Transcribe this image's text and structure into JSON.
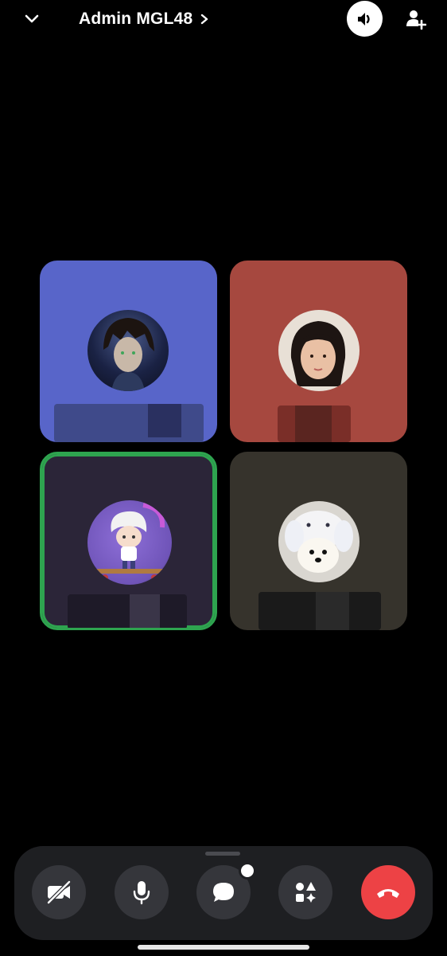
{
  "header": {
    "title": "Admin MGL48",
    "collapse_icon": "chevron-down-icon",
    "detail_icon": "chevron-right-icon",
    "speaker_icon": "speaker-icon",
    "add_user_icon": "add-user-icon"
  },
  "participants": [
    {
      "tile_color": "#5865c9",
      "avatar": "anime-boy-avatar",
      "name_redacted": true,
      "speaking": false
    },
    {
      "tile_color": "#a6483f",
      "avatar": "girl-photo-avatar",
      "name_redacted": true,
      "speaking": false
    },
    {
      "tile_color": "#2b2538",
      "avatar": "chibi-skateboard-avatar",
      "name_redacted": true,
      "speaking": true
    },
    {
      "tile_color": "#36332c",
      "avatar": "dog-costume-avatar",
      "name_redacted": true,
      "speaking": false
    }
  ],
  "call_controls": [
    {
      "icon": "camera-off-icon",
      "action": "toggle-camera"
    },
    {
      "icon": "microphone-icon",
      "action": "toggle-mic"
    },
    {
      "icon": "chat-bubble-icon",
      "action": "open-chat",
      "has_notification": true
    },
    {
      "icon": "activities-icon",
      "action": "activities"
    },
    {
      "icon": "hang-up-icon",
      "action": "end-call"
    }
  ],
  "colors": {
    "speaking_ring": "#2ea44f",
    "end_call": "#ed4245",
    "control_bg": "#35363b",
    "bar_bg": "#1e1f22"
  }
}
